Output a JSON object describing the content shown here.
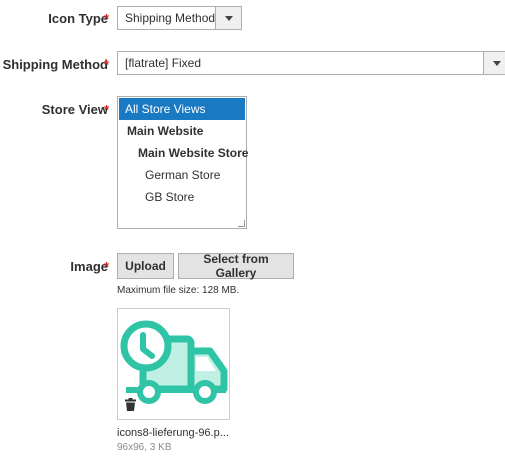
{
  "icon_type": {
    "label": "Icon Type",
    "required_mark": "*",
    "value": "Shipping Method"
  },
  "shipping_method": {
    "label": "Shipping Method",
    "required_mark": "*",
    "value": "[flatrate] Fixed"
  },
  "store_view": {
    "label": "Store View",
    "required_mark": "*",
    "options": [
      "All Store Views",
      "Main Website",
      "Main Website Store",
      "German Store",
      "GB Store"
    ]
  },
  "image": {
    "label": "Image",
    "required_mark": "*",
    "upload_label": "Upload",
    "gallery_label": "Select from Gallery",
    "note": "Maximum file size: 128 MB.",
    "file_name": "icons8-lieferung-96.p...",
    "file_meta": "96x96, 3 KB"
  },
  "colors": {
    "accent": "#1979c3",
    "required": "#e22626",
    "icon_teal": "#2ec4a5"
  },
  "icons": [
    "dropdown-arrow-icon",
    "delivery-truck-icon",
    "trash-icon"
  ]
}
